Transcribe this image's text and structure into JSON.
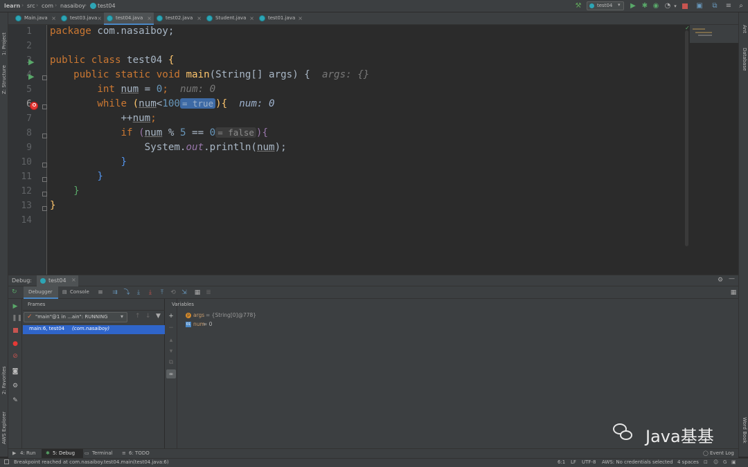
{
  "breadcrumb": [
    "learn",
    "src",
    "com",
    "nasaiboy",
    "test04"
  ],
  "run_config": "test04",
  "tabs": [
    "Main.java",
    "test03.java",
    "test04.java",
    "test02.java",
    "Student.java",
    "test01.java"
  ],
  "active_tab": "test04.java",
  "side_labels": {
    "project": "1: Project",
    "structure": "Z: Structure",
    "favorites": "2: Favorites",
    "aws_explorer": "AWS Explorer",
    "ant": "Ant",
    "database": "Database",
    "word_book": "Word Book"
  },
  "line_numbers": [
    "1",
    "2",
    "3",
    "4",
    "5",
    "6",
    "7",
    "8",
    "9",
    "10",
    "11",
    "12",
    "13",
    "14"
  ],
  "code": {
    "l1_kw": "package",
    "l1_rest": " com.nasaiboy;",
    "l3_kw": "public class",
    "l3_name": " test04",
    "l3_brace": " {",
    "l4_indent": "    ",
    "l4_kw": "public static void",
    "l4_fn": " main",
    "l4_rest": "(String[] args) {",
    "l4_hint": "  args: {}",
    "l5_indent": "        ",
    "l5_kw": "int",
    "l5_sp": " ",
    "l5_var": "num",
    "l5_eq": " = ",
    "l5_num": "0",
    "l5_semi": ";",
    "l5_hint": "  num: 0",
    "l6_indent": "        ",
    "l6_kw": "while",
    "l6_open": " (",
    "l6_var": "num",
    "l6_lt": "<",
    "l6_num": "100",
    "l6_inlay": "= true",
    "l6_close": ")",
    "l6_brace": "{",
    "l6_hint": "  num: 0",
    "l7_indent": "            ",
    "l7_inc": "++",
    "l7_var": "num",
    "l7_semi": ";",
    "l8_indent": "            ",
    "l8_kw": "if",
    "l8_open": " (",
    "l8_var": "num",
    "l8_mod": " % ",
    "l8_n5": "5",
    "l8_eq": " == ",
    "l8_n0": "0",
    "l8_inlay": "= false",
    "l8_close": ")",
    "l8_brace": "{",
    "l9_indent": "                ",
    "l9_sys": "System.",
    "l9_out": "out",
    "l9_call": ".println(",
    "l9_var": "num",
    "l9_end": ");",
    "l10": "            }",
    "l11": "        }",
    "l12": "    }",
    "l13": "}"
  },
  "debug": {
    "title": "Debug:",
    "session": "test04",
    "tab_debugger": "Debugger",
    "tab_console": "Console",
    "frames_label": "Frames",
    "variables_label": "Variables",
    "thread": "\"main\"@1 in ...ain\": RUNNING",
    "frame": "main:6, test04",
    "frame_pkg": "(com.nasaiboy)",
    "vars": [
      {
        "name": "args",
        "value": " = {String[0]@778}"
      },
      {
        "name": "num",
        "value": " = 0"
      }
    ]
  },
  "bottom_tools": {
    "run": "4: Run",
    "debug": "5: Debug",
    "terminal": "Terminal",
    "todo": "6: TODO",
    "event_log": "Event Log"
  },
  "status": {
    "message": "Breakpoint reached at com.nasaiboy.test04.main(test04.java:6)",
    "position": "6:1",
    "line_sep": "LF",
    "encoding": "UTF-8",
    "aws": "AWS: No credentials selected",
    "indent": "4 spaces"
  },
  "watermark": "Java基基",
  "colors": {
    "accent": "#2d5c9a",
    "keyword": "#cc7832",
    "function": "#ffc66d",
    "number": "#6897bb",
    "field": "#9876aa",
    "breakpoint": "#e53935"
  }
}
